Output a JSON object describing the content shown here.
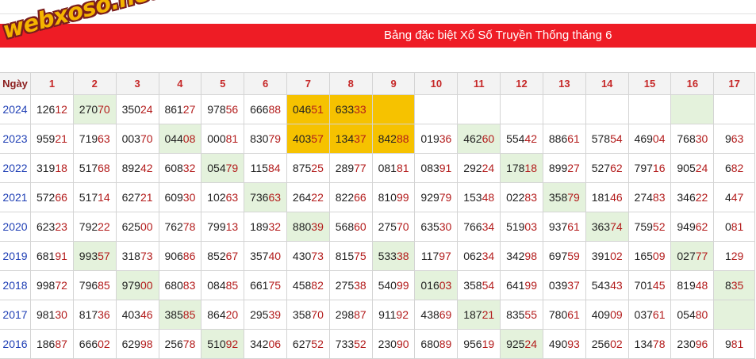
{
  "brand": {
    "logo_text": "webxoso.net"
  },
  "header": {
    "title": "Bảng đặc biệt Xổ Số Truyền Thống tháng 6"
  },
  "colors": {
    "banner": "#ee1c25",
    "today_highlight": "#f6c200",
    "week_marker": "#e4f2dc",
    "year_text": "#1f3fb5",
    "last_two_digits": "#b31b1b"
  },
  "table": {
    "corner_label": "Ngày",
    "days": [
      "1",
      "2",
      "3",
      "4",
      "5",
      "6",
      "7",
      "8",
      "9",
      "10",
      "11",
      "12",
      "13",
      "14",
      "15",
      "16",
      "17"
    ],
    "rows": [
      {
        "year": "2024",
        "cells": [
          {
            "pre": "126",
            "last": "12"
          },
          {
            "pre": "270",
            "last": "70",
            "green": true
          },
          {
            "pre": "350",
            "last": "24"
          },
          {
            "pre": "861",
            "last": "27"
          },
          {
            "pre": "978",
            "last": "56"
          },
          {
            "pre": "666",
            "last": "88"
          },
          {
            "pre": "046",
            "last": "51",
            "highlight": true
          },
          {
            "pre": "633",
            "last": "33",
            "highlight": true
          },
          {
            "pre": "",
            "last": "",
            "highlight": true
          },
          {
            "pre": "",
            "last": ""
          },
          {
            "pre": "",
            "last": ""
          },
          {
            "pre": "",
            "last": ""
          },
          {
            "pre": "",
            "last": ""
          },
          {
            "pre": "",
            "last": ""
          },
          {
            "pre": "",
            "last": ""
          },
          {
            "pre": "",
            "last": "",
            "green": true
          },
          {
            "pre": "",
            "last": ""
          }
        ]
      },
      {
        "year": "2023",
        "cells": [
          {
            "pre": "959",
            "last": "21"
          },
          {
            "pre": "719",
            "last": "63"
          },
          {
            "pre": "003",
            "last": "70"
          },
          {
            "pre": "044",
            "last": "08",
            "green": true
          },
          {
            "pre": "000",
            "last": "81"
          },
          {
            "pre": "830",
            "last": "79"
          },
          {
            "pre": "403",
            "last": "57",
            "highlight": true
          },
          {
            "pre": "134",
            "last": "37",
            "highlight": true
          },
          {
            "pre": "842",
            "last": "88",
            "highlight": true
          },
          {
            "pre": "019",
            "last": "36"
          },
          {
            "pre": "462",
            "last": "60",
            "green": true
          },
          {
            "pre": "554",
            "last": "42"
          },
          {
            "pre": "886",
            "last": "61"
          },
          {
            "pre": "578",
            "last": "54"
          },
          {
            "pre": "469",
            "last": "04"
          },
          {
            "pre": "768",
            "last": "30"
          },
          {
            "pre": "9",
            "last": "63"
          }
        ]
      },
      {
        "year": "2022",
        "cells": [
          {
            "pre": "319",
            "last": "18"
          },
          {
            "pre": "517",
            "last": "68"
          },
          {
            "pre": "892",
            "last": "42"
          },
          {
            "pre": "608",
            "last": "32"
          },
          {
            "pre": "054",
            "last": "79",
            "green": true
          },
          {
            "pre": "115",
            "last": "84"
          },
          {
            "pre": "875",
            "last": "25"
          },
          {
            "pre": "289",
            "last": "77"
          },
          {
            "pre": "081",
            "last": "81"
          },
          {
            "pre": "083",
            "last": "91"
          },
          {
            "pre": "292",
            "last": "24"
          },
          {
            "pre": "178",
            "last": "18",
            "green": true
          },
          {
            "pre": "899",
            "last": "27"
          },
          {
            "pre": "527",
            "last": "62"
          },
          {
            "pre": "797",
            "last": "16"
          },
          {
            "pre": "905",
            "last": "24"
          },
          {
            "pre": "6",
            "last": "82"
          }
        ]
      },
      {
        "year": "2021",
        "cells": [
          {
            "pre": "572",
            "last": "66"
          },
          {
            "pre": "517",
            "last": "14"
          },
          {
            "pre": "627",
            "last": "21"
          },
          {
            "pre": "609",
            "last": "30"
          },
          {
            "pre": "102",
            "last": "63"
          },
          {
            "pre": "736",
            "last": "63",
            "green": true
          },
          {
            "pre": "264",
            "last": "22"
          },
          {
            "pre": "822",
            "last": "66"
          },
          {
            "pre": "810",
            "last": "99"
          },
          {
            "pre": "929",
            "last": "79"
          },
          {
            "pre": "153",
            "last": "48"
          },
          {
            "pre": "022",
            "last": "83"
          },
          {
            "pre": "358",
            "last": "79",
            "green": true
          },
          {
            "pre": "181",
            "last": "46"
          },
          {
            "pre": "274",
            "last": "83"
          },
          {
            "pre": "346",
            "last": "22"
          },
          {
            "pre": "4",
            "last": "47"
          }
        ]
      },
      {
        "year": "2020",
        "cells": [
          {
            "pre": "623",
            "last": "23"
          },
          {
            "pre": "792",
            "last": "22"
          },
          {
            "pre": "625",
            "last": "00"
          },
          {
            "pre": "762",
            "last": "78"
          },
          {
            "pre": "799",
            "last": "13"
          },
          {
            "pre": "189",
            "last": "32"
          },
          {
            "pre": "880",
            "last": "39",
            "green": true
          },
          {
            "pre": "568",
            "last": "60"
          },
          {
            "pre": "275",
            "last": "70"
          },
          {
            "pre": "635",
            "last": "30"
          },
          {
            "pre": "766",
            "last": "34"
          },
          {
            "pre": "519",
            "last": "03"
          },
          {
            "pre": "937",
            "last": "61"
          },
          {
            "pre": "363",
            "last": "74",
            "green": true
          },
          {
            "pre": "759",
            "last": "52"
          },
          {
            "pre": "949",
            "last": "62"
          },
          {
            "pre": "0",
            "last": "81"
          }
        ]
      },
      {
        "year": "2019",
        "cells": [
          {
            "pre": "681",
            "last": "91"
          },
          {
            "pre": "993",
            "last": "57",
            "green": true
          },
          {
            "pre": "318",
            "last": "73"
          },
          {
            "pre": "906",
            "last": "86"
          },
          {
            "pre": "852",
            "last": "67"
          },
          {
            "pre": "357",
            "last": "40"
          },
          {
            "pre": "430",
            "last": "73"
          },
          {
            "pre": "815",
            "last": "75"
          },
          {
            "pre": "533",
            "last": "38",
            "green": true
          },
          {
            "pre": "117",
            "last": "97"
          },
          {
            "pre": "062",
            "last": "34"
          },
          {
            "pre": "342",
            "last": "98"
          },
          {
            "pre": "697",
            "last": "59"
          },
          {
            "pre": "391",
            "last": "02"
          },
          {
            "pre": "165",
            "last": "09"
          },
          {
            "pre": "027",
            "last": "77",
            "green": true
          },
          {
            "pre": "1",
            "last": "29"
          }
        ]
      },
      {
        "year": "2018",
        "cells": [
          {
            "pre": "998",
            "last": "72"
          },
          {
            "pre": "796",
            "last": "85"
          },
          {
            "pre": "979",
            "last": "00",
            "green": true
          },
          {
            "pre": "680",
            "last": "83"
          },
          {
            "pre": "084",
            "last": "85"
          },
          {
            "pre": "661",
            "last": "75"
          },
          {
            "pre": "458",
            "last": "82"
          },
          {
            "pre": "275",
            "last": "38"
          },
          {
            "pre": "540",
            "last": "99"
          },
          {
            "pre": "016",
            "last": "03",
            "green": true
          },
          {
            "pre": "358",
            "last": "54"
          },
          {
            "pre": "641",
            "last": "99"
          },
          {
            "pre": "039",
            "last": "37"
          },
          {
            "pre": "543",
            "last": "43"
          },
          {
            "pre": "701",
            "last": "45"
          },
          {
            "pre": "819",
            "last": "48"
          },
          {
            "pre": "8",
            "last": "35",
            "green": true
          }
        ]
      },
      {
        "year": "2017",
        "cells": [
          {
            "pre": "981",
            "last": "30"
          },
          {
            "pre": "817",
            "last": "36"
          },
          {
            "pre": "403",
            "last": "46"
          },
          {
            "pre": "385",
            "last": "85",
            "green": true
          },
          {
            "pre": "864",
            "last": "20"
          },
          {
            "pre": "295",
            "last": "39"
          },
          {
            "pre": "358",
            "last": "70"
          },
          {
            "pre": "298",
            "last": "87"
          },
          {
            "pre": "911",
            "last": "92"
          },
          {
            "pre": "438",
            "last": "69"
          },
          {
            "pre": "187",
            "last": "21",
            "green": true
          },
          {
            "pre": "835",
            "last": "55"
          },
          {
            "pre": "780",
            "last": "61"
          },
          {
            "pre": "409",
            "last": "09"
          },
          {
            "pre": "037",
            "last": "61"
          },
          {
            "pre": "054",
            "last": "80"
          },
          {
            "pre": "",
            "last": "",
            "green": true
          }
        ]
      },
      {
        "year": "2016",
        "cells": [
          {
            "pre": "186",
            "last": "87"
          },
          {
            "pre": "666",
            "last": "02"
          },
          {
            "pre": "629",
            "last": "98"
          },
          {
            "pre": "256",
            "last": "78"
          },
          {
            "pre": "510",
            "last": "92",
            "green": true
          },
          {
            "pre": "342",
            "last": "06"
          },
          {
            "pre": "627",
            "last": "52"
          },
          {
            "pre": "733",
            "last": "52"
          },
          {
            "pre": "230",
            "last": "90"
          },
          {
            "pre": "680",
            "last": "89"
          },
          {
            "pre": "956",
            "last": "19"
          },
          {
            "pre": "925",
            "last": "24",
            "green": true
          },
          {
            "pre": "490",
            "last": "93"
          },
          {
            "pre": "256",
            "last": "02"
          },
          {
            "pre": "134",
            "last": "78"
          },
          {
            "pre": "230",
            "last": "96"
          },
          {
            "pre": "9",
            "last": "81"
          }
        ]
      }
    ]
  }
}
